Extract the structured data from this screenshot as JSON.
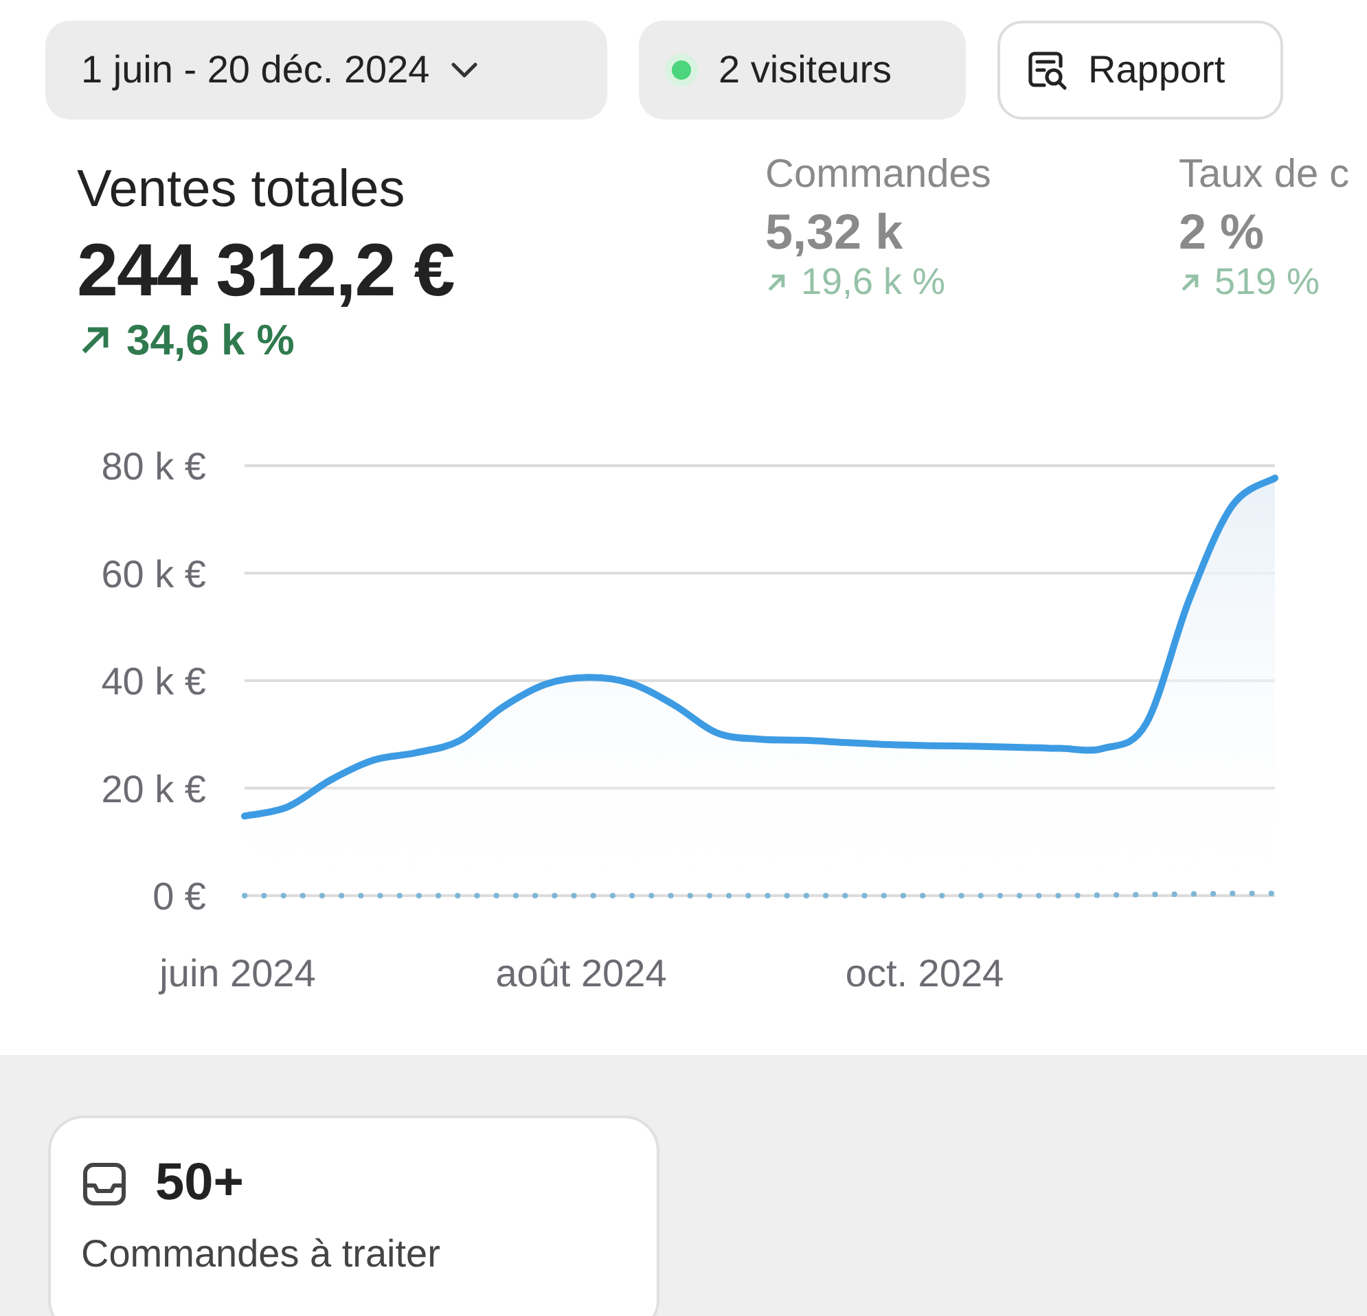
{
  "toolbar": {
    "date_range": "1 juin - 20 déc. 2024",
    "visitors": "2 visiteurs",
    "report_button": "Rapport"
  },
  "metrics": [
    {
      "label": "Ventes totales",
      "value": "244 312,2 €",
      "trend": "34,6 k %",
      "dimmed": false
    },
    {
      "label": "Commandes",
      "value": "5,32 k",
      "trend": "19,6 k %",
      "dimmed": true
    },
    {
      "label": "Taux de c",
      "value": "2 %",
      "trend": "519 %",
      "dimmed": true
    }
  ],
  "chart": {
    "chart_data": {
      "type": "line",
      "categories": [
        "juin 2024",
        null,
        null,
        null,
        null,
        null,
        null,
        null,
        "août 2024",
        null,
        null,
        null,
        null,
        null,
        null,
        null,
        "oct. 2024",
        null,
        null,
        null,
        null,
        null,
        null,
        null,
        null
      ],
      "series": [
        {
          "type": "area",
          "color": "#3d9be3",
          "values": [
            14800,
            16500,
            21500,
            25200,
            26600,
            28800,
            35000,
            39300,
            40600,
            39500,
            35500,
            30300,
            29100,
            28900,
            28500,
            28100,
            27900,
            27800,
            27600,
            27400,
            27400,
            32000,
            55000,
            72500,
            77700
          ]
        },
        {
          "type": "line",
          "line_style": "dotted",
          "color": "#7fb6d6",
          "values": [
            0,
            0,
            0,
            0,
            0,
            0,
            0,
            0,
            0,
            0,
            0,
            0,
            0,
            0,
            0,
            0,
            0,
            0,
            0,
            0,
            100,
            200,
            300,
            400,
            400
          ]
        }
      ],
      "ylim": [
        0,
        80000
      ],
      "grid": true,
      "yticks": [
        {
          "value": 0,
          "label": "0 €"
        },
        {
          "value": 20000,
          "label": "20 k €"
        },
        {
          "value": 40000,
          "label": "40 k €"
        },
        {
          "value": 60000,
          "label": "60 k €"
        },
        {
          "value": 80000,
          "label": "80 k €"
        }
      ]
    }
  },
  "tasks": [
    {
      "count": "50+",
      "label": "Commandes à traiter"
    }
  ]
}
